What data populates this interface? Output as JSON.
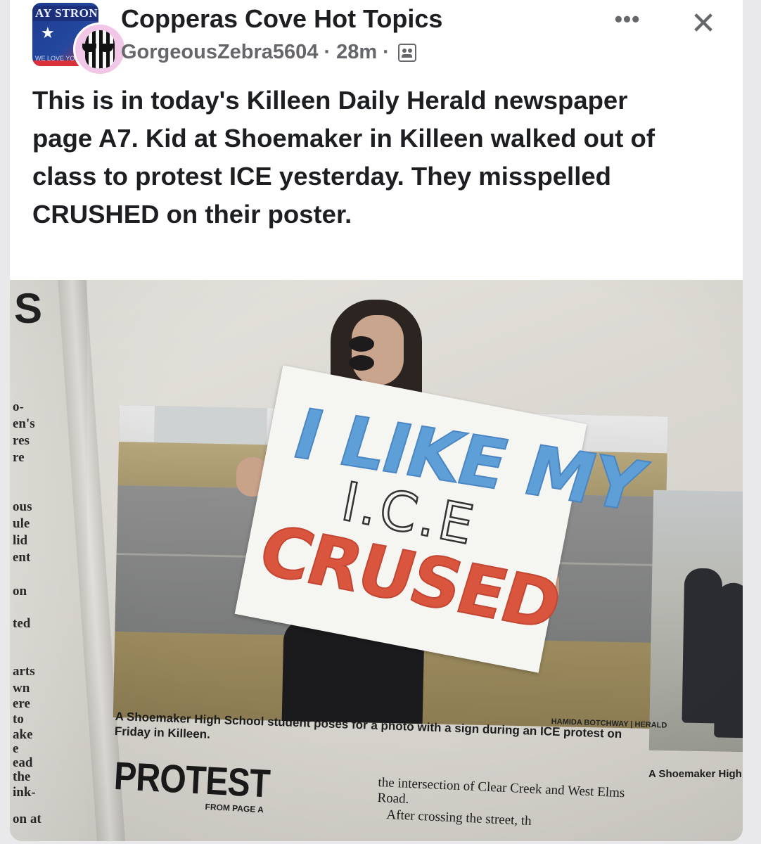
{
  "post": {
    "group_name": "Copperas Cove Hot Topics",
    "author": "GorgeousZebra5604",
    "separator": "·",
    "time": "28m",
    "audience_icon": "group-members-icon",
    "more_label": "•••",
    "close_label": "✕",
    "text": "This is in today's Killeen Daily Herald newspaper page A7.  Kid at Shoemaker in Killeen walked out of class to protest ICE yesterday.  They misspelled CRUSHED on their poster."
  },
  "group_avatar": {
    "banner_text": "AY STRON",
    "tag_text": "WE LOVE YO"
  },
  "newspaper": {
    "left_fragments": [
      "S",
      "o-",
      "en's",
      "res",
      "re",
      "ous",
      "ule",
      "lid",
      "ent",
      "on",
      "ted",
      "arts",
      "wn",
      "ere",
      "to",
      "ake",
      "e",
      "ead",
      "the",
      "ink-",
      "on at"
    ],
    "sign": {
      "line1": "I LIKE MY",
      "line2": "I.C.E",
      "line3": "CRUSED"
    },
    "caption": "A Shoemaker High School student poses for a photo with a sign during an ICE protest on Friday in Killeen.",
    "credit": "HAMIDA BOTCHWAY | HERALD",
    "headline": "PROTEST",
    "from_page": "FROM PAGE A",
    "body_line1": "the intersection of Clear Creek and West Elms Road.",
    "body_line2": "After crossing the street, th",
    "side_caption": "A Shoemaker High"
  },
  "colors": {
    "sign_blue": "#5f9fd8",
    "sign_red": "#d9553e",
    "text_primary": "#1c1e21",
    "text_secondary": "#65676b"
  }
}
